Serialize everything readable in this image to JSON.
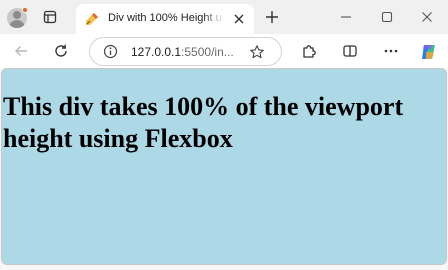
{
  "window": {
    "tab": {
      "title": "Div with 100% Height using Flexbox",
      "favicon": "html-favicon-icon"
    }
  },
  "toolbar": {
    "url": {
      "host": "127.0.0.1",
      "path": ":5500/in..."
    },
    "icons": [
      "back-icon",
      "refresh-icon",
      "info-icon",
      "star-icon",
      "extensions-icon",
      "split-screen-icon",
      "more-icon",
      "copilot-icon"
    ]
  },
  "page": {
    "heading": "This div takes 100% of the viewport height using Flexbox",
    "background_color": "#add8e6"
  }
}
